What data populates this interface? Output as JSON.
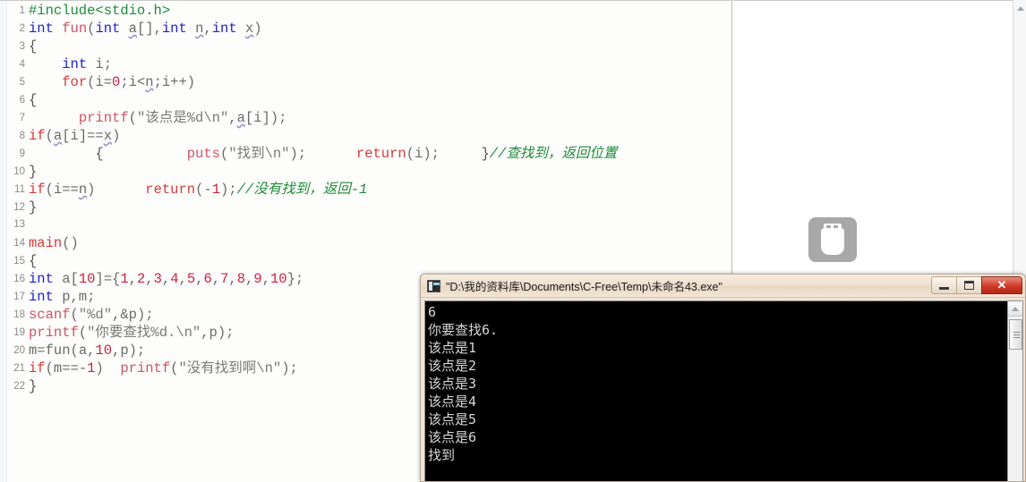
{
  "editor": {
    "lines": [
      {
        "n": "1",
        "tokens": [
          {
            "t": "#include<stdio.h>",
            "c": "t-pre"
          }
        ]
      },
      {
        "n": "2",
        "tokens": [
          {
            "t": "int",
            "c": "t-kw"
          },
          {
            "t": " ",
            "c": "t-plain"
          },
          {
            "t": "fun",
            "c": "t-fn"
          },
          {
            "t": "(",
            "c": "t-punct"
          },
          {
            "t": "int",
            "c": "t-kw"
          },
          {
            "t": " ",
            "c": "t-plain"
          },
          {
            "t": "a",
            "c": "t-plain sq"
          },
          {
            "t": "[],",
            "c": "t-punct"
          },
          {
            "t": "int",
            "c": "t-kw"
          },
          {
            "t": " ",
            "c": "t-plain"
          },
          {
            "t": "n",
            "c": "t-plain sq"
          },
          {
            "t": ",",
            "c": "t-punct"
          },
          {
            "t": "int",
            "c": "t-kw"
          },
          {
            "t": " ",
            "c": "t-plain"
          },
          {
            "t": "x",
            "c": "t-plain sq"
          },
          {
            "t": ")",
            "c": "t-punct"
          }
        ]
      },
      {
        "n": "3",
        "tokens": [
          {
            "t": "{",
            "c": "t-brace"
          }
        ]
      },
      {
        "n": "4",
        "tokens": [
          {
            "t": "    ",
            "c": "t-plain"
          },
          {
            "t": "int",
            "c": "t-kw"
          },
          {
            "t": " i;",
            "c": "t-plain"
          }
        ]
      },
      {
        "n": "5",
        "tokens": [
          {
            "t": "    ",
            "c": "t-plain"
          },
          {
            "t": "for",
            "c": "t-ctl"
          },
          {
            "t": "(i=",
            "c": "t-plain"
          },
          {
            "t": "0",
            "c": "t-num"
          },
          {
            "t": ";i<",
            "c": "t-plain"
          },
          {
            "t": "n",
            "c": "t-plain sq"
          },
          {
            "t": ";i++)",
            "c": "t-plain"
          }
        ]
      },
      {
        "n": "6",
        "tokens": [
          {
            "t": "{",
            "c": "t-brace"
          }
        ]
      },
      {
        "n": "7",
        "tokens": [
          {
            "t": "      ",
            "c": "t-plain"
          },
          {
            "t": "printf",
            "c": "t-fn"
          },
          {
            "t": "(",
            "c": "t-punct"
          },
          {
            "t": "\"该点是%d\\n\"",
            "c": "t-str"
          },
          {
            "t": ",",
            "c": "t-punct"
          },
          {
            "t": "a",
            "c": "t-plain sq"
          },
          {
            "t": "[i]);",
            "c": "t-punct"
          }
        ]
      },
      {
        "n": "8",
        "tokens": [
          {
            "t": "if",
            "c": "t-ctl"
          },
          {
            "t": "(",
            "c": "t-punct"
          },
          {
            "t": "a",
            "c": "t-plain sq"
          },
          {
            "t": "[i]==",
            "c": "t-plain"
          },
          {
            "t": "x",
            "c": "t-plain sq"
          },
          {
            "t": ")",
            "c": "t-punct"
          }
        ]
      },
      {
        "n": "9",
        "tokens": [
          {
            "t": "        {          ",
            "c": "t-brace"
          },
          {
            "t": "puts",
            "c": "t-fn"
          },
          {
            "t": "(",
            "c": "t-punct"
          },
          {
            "t": "\"找到\\n\"",
            "c": "t-str"
          },
          {
            "t": ");      ",
            "c": "t-punct"
          },
          {
            "t": "return",
            "c": "t-ctl"
          },
          {
            "t": "(i);     ",
            "c": "t-plain"
          },
          {
            "t": "}",
            "c": "t-brace"
          },
          {
            "t": "//查找到，返回位置",
            "c": "t-cmt"
          }
        ]
      },
      {
        "n": "10",
        "tokens": [
          {
            "t": "}",
            "c": "t-brace"
          }
        ]
      },
      {
        "n": "11",
        "tokens": [
          {
            "t": "if",
            "c": "t-ctl"
          },
          {
            "t": "(i==",
            "c": "t-plain"
          },
          {
            "t": "n",
            "c": "t-plain sq"
          },
          {
            "t": ")      ",
            "c": "t-plain"
          },
          {
            "t": "return",
            "c": "t-ctl"
          },
          {
            "t": "(-",
            "c": "t-plain"
          },
          {
            "t": "1",
            "c": "t-num"
          },
          {
            "t": ");",
            "c": "t-plain"
          },
          {
            "t": "//没有找到，返回-1",
            "c": "t-cmt"
          }
        ]
      },
      {
        "n": "12",
        "tokens": [
          {
            "t": "}",
            "c": "t-brace"
          }
        ]
      },
      {
        "n": "13",
        "tokens": [
          {
            "t": "",
            "c": "t-plain"
          }
        ]
      },
      {
        "n": "14",
        "tokens": [
          {
            "t": "main",
            "c": "t-ctl"
          },
          {
            "t": "()",
            "c": "t-punct"
          }
        ]
      },
      {
        "n": "15",
        "tokens": [
          {
            "t": "{",
            "c": "t-brace"
          }
        ]
      },
      {
        "n": "16",
        "tokens": [
          {
            "t": "int",
            "c": "t-kw"
          },
          {
            "t": " a[",
            "c": "t-plain"
          },
          {
            "t": "10",
            "c": "t-num"
          },
          {
            "t": "]={",
            "c": "t-plain"
          },
          {
            "t": "1",
            "c": "t-num"
          },
          {
            "t": ",",
            "c": "t-punct"
          },
          {
            "t": "2",
            "c": "t-num"
          },
          {
            "t": ",",
            "c": "t-punct"
          },
          {
            "t": "3",
            "c": "t-num"
          },
          {
            "t": ",",
            "c": "t-punct"
          },
          {
            "t": "4",
            "c": "t-num"
          },
          {
            "t": ",",
            "c": "t-punct"
          },
          {
            "t": "5",
            "c": "t-num"
          },
          {
            "t": ",",
            "c": "t-punct"
          },
          {
            "t": "6",
            "c": "t-num"
          },
          {
            "t": ",",
            "c": "t-punct"
          },
          {
            "t": "7",
            "c": "t-num"
          },
          {
            "t": ",",
            "c": "t-punct"
          },
          {
            "t": "8",
            "c": "t-num"
          },
          {
            "t": ",",
            "c": "t-punct"
          },
          {
            "t": "9",
            "c": "t-num"
          },
          {
            "t": ",",
            "c": "t-punct"
          },
          {
            "t": "10",
            "c": "t-num"
          },
          {
            "t": "};",
            "c": "t-plain"
          }
        ]
      },
      {
        "n": "17",
        "tokens": [
          {
            "t": "int",
            "c": "t-kw"
          },
          {
            "t": " p,m;",
            "c": "t-plain"
          }
        ]
      },
      {
        "n": "18",
        "tokens": [
          {
            "t": "scanf",
            "c": "t-fn"
          },
          {
            "t": "(",
            "c": "t-punct"
          },
          {
            "t": "\"%d\"",
            "c": "t-str"
          },
          {
            "t": ",&p);",
            "c": "t-punct"
          }
        ]
      },
      {
        "n": "19",
        "tokens": [
          {
            "t": "printf",
            "c": "t-fn"
          },
          {
            "t": "(",
            "c": "t-punct"
          },
          {
            "t": "\"你要查找%d.\\n\"",
            "c": "t-str"
          },
          {
            "t": ",p);",
            "c": "t-punct"
          }
        ]
      },
      {
        "n": "20",
        "tokens": [
          {
            "t": "m=",
            "c": "t-plain"
          },
          {
            "t": "fun",
            "c": "t-plain"
          },
          {
            "t": "(a,",
            "c": "t-plain"
          },
          {
            "t": "10",
            "c": "t-num"
          },
          {
            "t": ",p);",
            "c": "t-plain"
          }
        ]
      },
      {
        "n": "21",
        "tokens": [
          {
            "t": "if",
            "c": "t-ctl"
          },
          {
            "t": "(m==-",
            "c": "t-plain"
          },
          {
            "t": "1",
            "c": "t-num"
          },
          {
            "t": ")  ",
            "c": "t-plain"
          },
          {
            "t": "printf",
            "c": "t-fn"
          },
          {
            "t": "(",
            "c": "t-punct"
          },
          {
            "t": "\"没有找到啊\\n\"",
            "c": "t-str"
          },
          {
            "t": ");",
            "c": "t-punct"
          }
        ]
      },
      {
        "n": "22",
        "tokens": [
          {
            "t": "}",
            "c": "t-brace"
          }
        ]
      }
    ]
  },
  "console": {
    "title": "\"D:\\我的资料库\\Documents\\C-Free\\Temp\\未命名43.exe\"",
    "minimize_label": "",
    "maximize_label": "",
    "close_label": "✕",
    "output": "6\n你要查找6.\n该点是1\n该点是2\n该点是3\n该点是4\n该点是5\n该点是6\n找到\n\n请按任意键继续. . ."
  },
  "desktop": {
    "usb_icon_name": "usb-drive-icon"
  },
  "colors": {
    "preprocessor": "#1f8a3c",
    "keyword": "#2222cc",
    "control": "#d23c3c",
    "number": "#cc2244",
    "comment": "#1f8a3c",
    "string": "#7a7a7a",
    "console_bg": "#000000",
    "console_fg": "#d8d8d8",
    "titlebar_bg": "#efe0cf",
    "close_button": "#cf3a26"
  }
}
